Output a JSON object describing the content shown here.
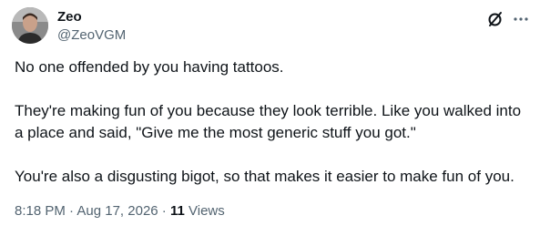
{
  "author": {
    "name": "Zeo",
    "handle": "@ZeoVGM"
  },
  "icons": {
    "grok": "grok-slash-icon",
    "more": "more-horizontal-icon"
  },
  "tweet": {
    "paragraphs": [
      "No one offended by you having tattoos.",
      "They're making fun of you because they look terrible. Like you walked into a place and said, \"Give me the most generic stuff you got.\"",
      "You're also a disgusting bigot, so that makes it easier to make fun of you."
    ]
  },
  "meta": {
    "time": "8:18 PM",
    "separator1": " · ",
    "date": "Aug 17, 2026",
    "separator2": " · ",
    "views_count": "11",
    "views_label": " Views"
  },
  "colors": {
    "text_primary": "#0f1419",
    "text_secondary": "#536471",
    "background": "#ffffff"
  }
}
